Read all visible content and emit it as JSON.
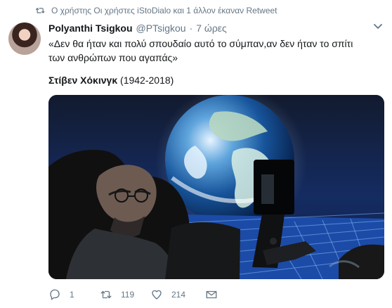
{
  "retweet_line": {
    "text": "Ο χρήστης Οι χρήστες iStoDialo και 1 άλλον έκαναν Retweet",
    "icon": "retweet-icon"
  },
  "tweet": {
    "author_name": "Polyanthi Tsigkou",
    "handle": "@PTsigkou",
    "separator": "·",
    "time": "7 ώρες",
    "text": "«Δεν θα ήταν και πολύ σπουδαίο αυτό το σύμπαν,αν δεν ήταν το σπίτι των ανθρώπων που αγαπάς»",
    "attribution_name": "Στίβεν Χόκινγκ",
    "attribution_years": "(1942-2018)"
  },
  "actions": {
    "reply": {
      "icon": "reply-icon",
      "count": "1"
    },
    "retweet": {
      "icon": "retweet-icon",
      "count": "119"
    },
    "like": {
      "icon": "heart-icon",
      "count": "214"
    },
    "message": {
      "icon": "envelope-icon"
    }
  },
  "colors": {
    "text": "#14171a",
    "muted": "#657786",
    "accent": "#1da1f2"
  }
}
